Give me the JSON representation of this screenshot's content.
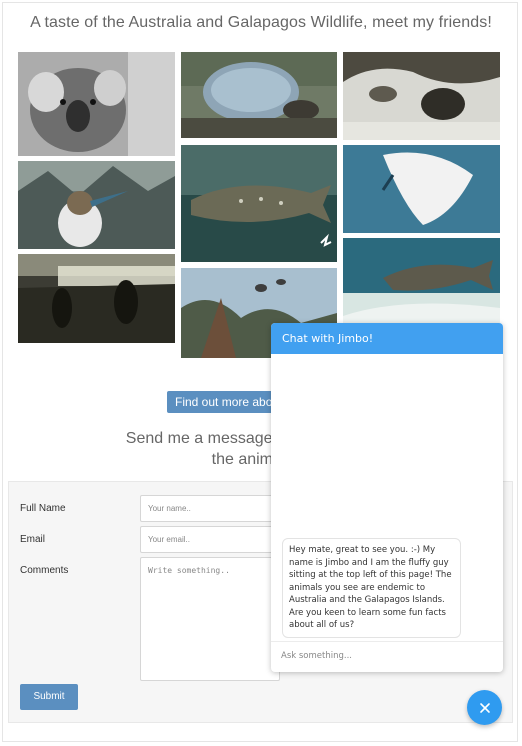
{
  "gallery": {
    "title": "A taste of the Australia and Galapagos Wildlife, meet my friends!",
    "photos": [
      {
        "name": "photo-koala",
        "subject": "koala"
      },
      {
        "name": "photo-giant-tortoise",
        "subject": "giant tortoise"
      },
      {
        "name": "photo-sea-lion-rocks",
        "subject": "sea lion on rocks"
      },
      {
        "name": "photo-blue-footed-booby",
        "subject": "blue-footed booby"
      },
      {
        "name": "photo-whale-shark",
        "subject": "whale shark"
      },
      {
        "name": "photo-manta-ray",
        "subject": "manta ray"
      },
      {
        "name": "photo-sunset-silhouettes",
        "subject": "sunset silhouettes"
      },
      {
        "name": "photo-reef-shark",
        "subject": "reef shark"
      },
      {
        "name": "photo-birds-tree",
        "subject": "birds in tree"
      }
    ]
  },
  "find_more_button": "Find out more abou",
  "message_heading": {
    "line1": "Send me a message or use the chat b",
    "line2": "the animals in"
  },
  "form": {
    "full_name_label": "Full Name",
    "full_name_placeholder": "Your name..",
    "email_label": "Email",
    "email_placeholder": "Your email..",
    "comments_label": "Comments",
    "comments_placeholder": "Write something..",
    "submit_label": "Submit"
  },
  "chat": {
    "title": "Chat with Jimbo!",
    "bot_message": "Hey mate, great to see you. :-) My name is Jimbo and I am the fluffy guy sitting at the top left of this page! The animals you see are endemic to Australia and the Galapagos Islands. Are you keen to learn some fun facts about all of us?",
    "input_placeholder": "Ask something...",
    "fab_icon": "close-icon"
  },
  "colors": {
    "accent": "#5b8fc0",
    "chat_header": "#41a0f0",
    "fab": "#2f9bf0"
  }
}
